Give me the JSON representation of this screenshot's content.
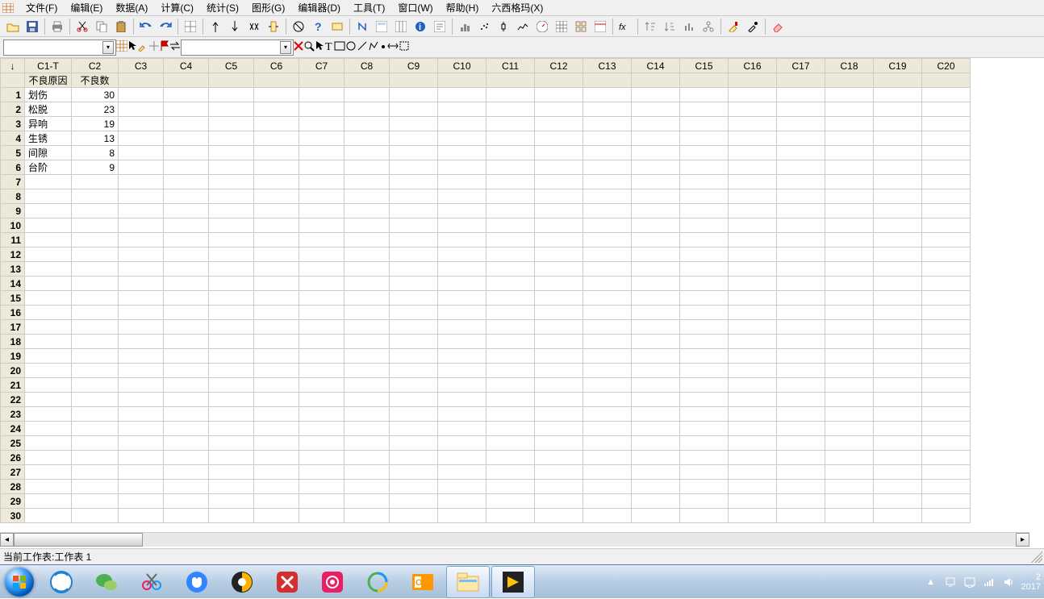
{
  "menubar": {
    "items": [
      "文件(F)",
      "编辑(E)",
      "数据(A)",
      "计算(C)",
      "统计(S)",
      "图形(G)",
      "编辑器(D)",
      "工具(T)",
      "窗口(W)",
      "帮助(H)",
      "六西格玛(X)"
    ]
  },
  "toolbar1": {
    "buttons": [
      "open",
      "save",
      "print",
      "cut",
      "copy",
      "paste",
      "undo",
      "redo",
      "worksheet",
      "up",
      "down",
      "find",
      "insert-col",
      "cancel",
      "help",
      "brush",
      "assign",
      "cols",
      "rows",
      "info",
      "sigma",
      "hist",
      "pareto",
      "scatter",
      "boxplot",
      "time",
      "calc",
      "table",
      "gage",
      "fx",
      "sort-asc",
      "sort-desc",
      "chart",
      "tree",
      "brush2",
      "eyedrop",
      "erase"
    ]
  },
  "toolbar2": {
    "combo1": "",
    "combo2": "",
    "buttons_a": [
      "sheet",
      "pointer",
      "brush",
      "plus",
      "flag",
      "swap"
    ],
    "buttons_b": [
      "cancel-x",
      "zoom"
    ],
    "buttons_c": [
      "select",
      "text",
      "rect",
      "circle",
      "line",
      "poly",
      "dot",
      "marker",
      "region"
    ]
  },
  "grid": {
    "corner": "↓",
    "col_headers": [
      "C1-T",
      "C2",
      "C3",
      "C4",
      "C5",
      "C6",
      "C7",
      "C8",
      "C9",
      "C10",
      "C11",
      "C12",
      "C13",
      "C14",
      "C15",
      "C16",
      "C17",
      "C18",
      "C19",
      "C20"
    ],
    "subheaders": [
      "不良原因",
      "不良数",
      "",
      "",
      "",
      "",
      "",
      "",
      "",
      "",
      "",
      "",
      "",
      "",
      "",
      "",
      "",
      "",
      "",
      ""
    ],
    "rows": 30,
    "data": [
      [
        "划伤",
        "30"
      ],
      [
        "松脱",
        "23"
      ],
      [
        "异响",
        "19"
      ],
      [
        "生锈",
        "13"
      ],
      [
        "间隙",
        "8"
      ],
      [
        "台阶",
        "9"
      ]
    ]
  },
  "chart_data": {
    "type": "table",
    "title": "不良原因 / 不良数",
    "categories": [
      "划伤",
      "松脱",
      "异响",
      "生锈",
      "间隙",
      "台阶"
    ],
    "values": [
      30,
      23,
      19,
      13,
      8,
      9
    ],
    "xlabel": "不良原因",
    "ylabel": "不良数"
  },
  "status": {
    "text": "当前工作表:工作表 1"
  },
  "taskbar": {
    "apps": [
      "browser",
      "wechat",
      "snip",
      "baidu",
      "player",
      "xmind",
      "camera",
      "cloud",
      "outlook",
      "explorer",
      "labview"
    ],
    "tray": {
      "up": "▲",
      "net": "⊞",
      "monitor": "🖥",
      "wifi": "▮",
      "vol": "🔊"
    },
    "clock_line1": "2",
    "clock_line2": "2017"
  }
}
